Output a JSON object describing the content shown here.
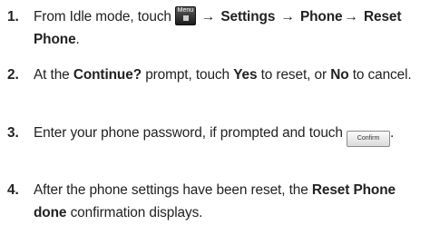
{
  "steps": [
    {
      "number": "1.",
      "text_before_icon": "From Idle mode, touch",
      "menu_key_label": "Menu",
      "arrow": "→",
      "path_settings": "Settings",
      "path_phone": "Phone",
      "path_reset_phone": "Reset Phone",
      "period": "."
    },
    {
      "number": "2.",
      "text_at_the": "At the",
      "prompt_name": "Continue?",
      "text_prompt_touch": "prompt, touch",
      "yes_label": "Yes",
      "text_to_reset_or": "to reset, or",
      "no_label": "No",
      "text_to_cancel": "to cancel."
    },
    {
      "number": "3.",
      "text": "Enter your phone password, if prompted and touch",
      "confirm_button_label": "Confirm",
      "period": "."
    },
    {
      "number": "4.",
      "text_before": "After the phone settings have been reset, the",
      "status_name": "Reset Phone done",
      "text_after": "confirmation displays."
    }
  ]
}
